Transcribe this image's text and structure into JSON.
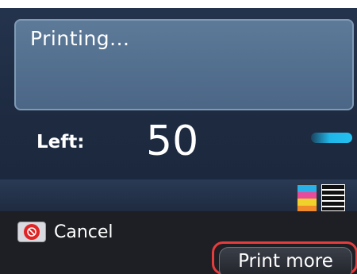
{
  "status": {
    "message": "Printing..."
  },
  "copies": {
    "label": "Left:",
    "count": "50"
  },
  "icons": {
    "progress": "progress-bar-icon",
    "color_mode": "color-ink-icon",
    "bw_mode": "black-ink-icon",
    "stop": "stop-icon"
  },
  "actions": {
    "cancel_label": "Cancel",
    "print_more_label": "Print more"
  },
  "colors": {
    "screen_bg": "#1d2a40",
    "message_box": "#566f8e",
    "progress": "#1fb6e7",
    "stop_button": "#e02424",
    "focus_outline": "#e53c3c"
  }
}
